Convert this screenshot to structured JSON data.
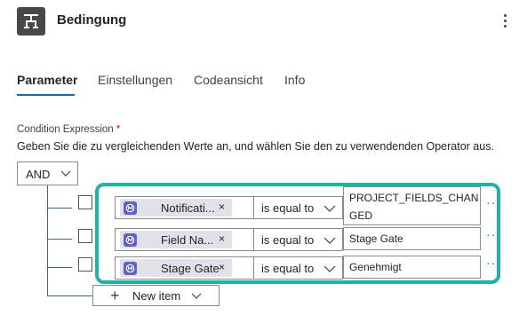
{
  "header": {
    "title": "Bedingung",
    "app_icon": "condition-icon",
    "more_icon": "more-vertical-icon"
  },
  "tabs": [
    {
      "label": "Parameter",
      "active": true
    },
    {
      "label": "Einstellungen",
      "active": false
    },
    {
      "label": "Codeansicht",
      "active": false
    },
    {
      "label": "Info",
      "active": false
    }
  ],
  "condition": {
    "label": "Condition Expression",
    "required_marker": "*",
    "description": "Geben Sie die zu vergleichenden Werte an, und wählen Sie den zu verwendenden Operator aus.",
    "group_operator": "AND",
    "rows": [
      {
        "token_label": "Notificati...",
        "operator": "is equal to",
        "value_line1": "PROJECT_FIELDS_CHAN",
        "value_line2": "GED"
      },
      {
        "token_label": "Field Na...",
        "operator": "is equal to",
        "value_line1": "Stage Gate",
        "value_line2": ""
      },
      {
        "token_label": "Stage Gate",
        "operator": "is equal to",
        "value_line1": "Genehmigt",
        "value_line2": ""
      }
    ],
    "token_close": "×",
    "row_more": "···",
    "new_item_label": "New item",
    "new_item_plus": "+"
  },
  "colors": {
    "highlight": "#1cb3a8",
    "tab_underline": "#0f6cbd",
    "token_icon": "#5f61c6",
    "tree_lines": "#2b6cb0"
  }
}
